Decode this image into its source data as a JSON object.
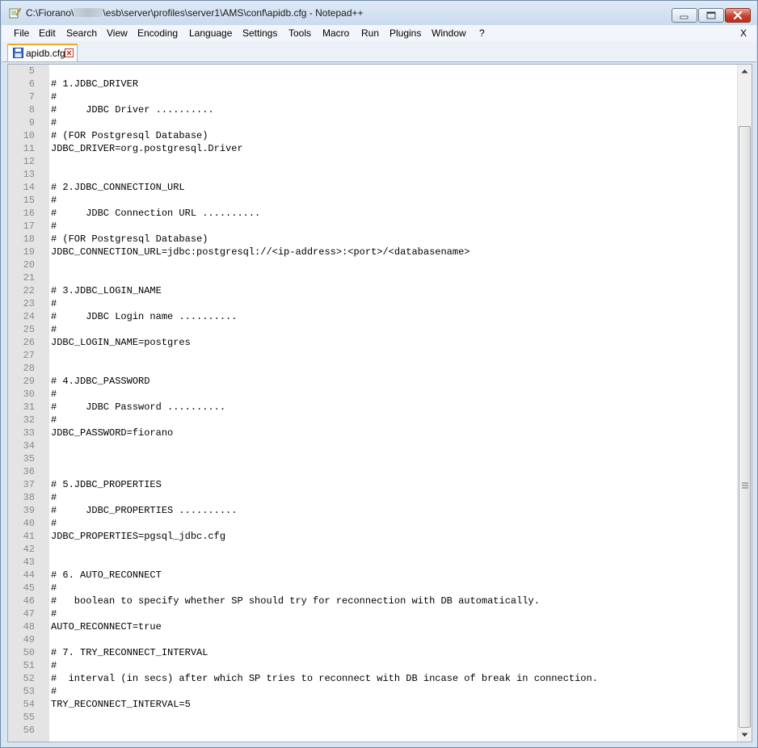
{
  "window": {
    "title_prefix": "C:\\Fiorano\\",
    "title_suffix": "\\esb\\server\\profiles\\server1\\AMS\\conf\\apidb.cfg - Notepad++"
  },
  "menu": {
    "items": [
      "File",
      "Edit",
      "Search",
      "View",
      "Encoding",
      "Language",
      "Settings",
      "Tools",
      "Macro",
      "Run",
      "Plugins",
      "Window",
      "?"
    ],
    "close_doc": "X"
  },
  "tab": {
    "label": "apidb.cfg"
  },
  "editor": {
    "lines": [
      {
        "n": "5",
        "t": ""
      },
      {
        "n": "6",
        "t": "# 1.JDBC_DRIVER"
      },
      {
        "n": "7",
        "t": "#"
      },
      {
        "n": "8",
        "t": "#     JDBC Driver .........."
      },
      {
        "n": "9",
        "t": "#"
      },
      {
        "n": "10",
        "t": "# (FOR Postgresql Database)"
      },
      {
        "n": "11",
        "t": "JDBC_DRIVER=org.postgresql.Driver"
      },
      {
        "n": "12",
        "t": ""
      },
      {
        "n": "13",
        "t": ""
      },
      {
        "n": "14",
        "t": "# 2.JDBC_CONNECTION_URL"
      },
      {
        "n": "15",
        "t": "#"
      },
      {
        "n": "16",
        "t": "#     JDBC Connection URL .........."
      },
      {
        "n": "17",
        "t": "#"
      },
      {
        "n": "18",
        "t": "# (FOR Postgresql Database)"
      },
      {
        "n": "19",
        "t": "JDBC_CONNECTION_URL=jdbc:postgresql://<ip-address>:<port>/<databasename>"
      },
      {
        "n": "20",
        "t": ""
      },
      {
        "n": "21",
        "t": ""
      },
      {
        "n": "22",
        "t": "# 3.JDBC_LOGIN_NAME"
      },
      {
        "n": "23",
        "t": "#"
      },
      {
        "n": "24",
        "t": "#     JDBC Login name .........."
      },
      {
        "n": "25",
        "t": "#"
      },
      {
        "n": "26",
        "t": "JDBC_LOGIN_NAME=postgres"
      },
      {
        "n": "27",
        "t": ""
      },
      {
        "n": "28",
        "t": ""
      },
      {
        "n": "29",
        "t": "# 4.JDBC_PASSWORD"
      },
      {
        "n": "30",
        "t": "#"
      },
      {
        "n": "31",
        "t": "#     JDBC Password .........."
      },
      {
        "n": "32",
        "t": "#"
      },
      {
        "n": "33",
        "t": "JDBC_PASSWORD=fiorano"
      },
      {
        "n": "34",
        "t": ""
      },
      {
        "n": "35",
        "t": ""
      },
      {
        "n": "36",
        "t": ""
      },
      {
        "n": "37",
        "t": "# 5.JDBC_PROPERTIES"
      },
      {
        "n": "38",
        "t": "#"
      },
      {
        "n": "39",
        "t": "#     JDBC_PROPERTIES .........."
      },
      {
        "n": "40",
        "t": "#"
      },
      {
        "n": "41",
        "t": "JDBC_PROPERTIES=pgsql_jdbc.cfg"
      },
      {
        "n": "42",
        "t": ""
      },
      {
        "n": "43",
        "t": ""
      },
      {
        "n": "44",
        "t": "# 6. AUTO_RECONNECT"
      },
      {
        "n": "45",
        "t": "#"
      },
      {
        "n": "46",
        "t": "#   boolean to specify whether SP should try for reconnection with DB automatically."
      },
      {
        "n": "47",
        "t": "#"
      },
      {
        "n": "48",
        "t": "AUTO_RECONNECT=true"
      },
      {
        "n": "49",
        "t": ""
      },
      {
        "n": "50",
        "t": "# 7. TRY_RECONNECT_INTERVAL"
      },
      {
        "n": "51",
        "t": "#"
      },
      {
        "n": "52",
        "t": "#  interval (in secs) after which SP tries to reconnect with DB incase of break in connection."
      },
      {
        "n": "53",
        "t": "#"
      },
      {
        "n": "54",
        "t": "TRY_RECONNECT_INTERVAL=5"
      },
      {
        "n": "55",
        "t": ""
      },
      {
        "n": "56",
        "t": ""
      }
    ]
  },
  "icons": {
    "app": "notepad-icon",
    "minimize": "minimize-icon",
    "maximize": "maximize-icon",
    "close": "close-icon",
    "tab_file": "floppy-disk-icon",
    "tab_close": "tab-close-icon",
    "scroll_up": "arrow-up-icon",
    "scroll_down": "arrow-down-icon",
    "grip": "scroll-grip-icon"
  },
  "colors": {
    "gutter": "#e4e4e4",
    "tab_accent": "#f5a623",
    "close_button": "#c9412b"
  }
}
